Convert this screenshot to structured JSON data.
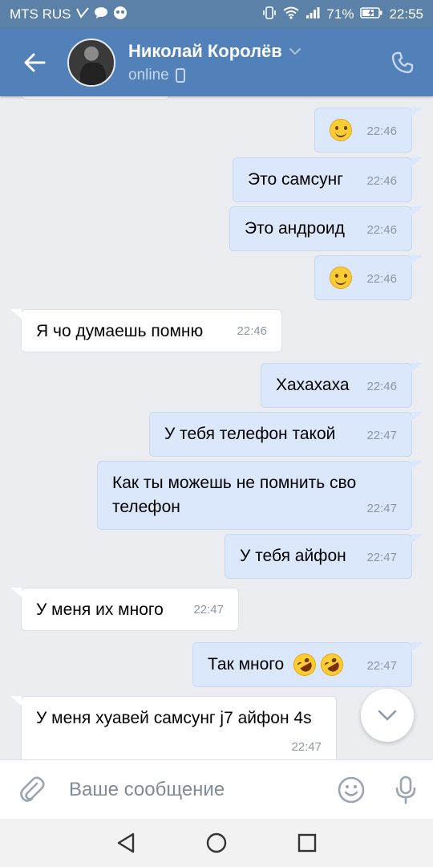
{
  "status_bar": {
    "carrier": "MTS RUS",
    "battery": "71%",
    "time": "22:55"
  },
  "header": {
    "contact_name": "Николай Королёв",
    "status": "online"
  },
  "messages": [
    {
      "direction": "out",
      "text": "",
      "emoji": [
        "smile"
      ],
      "time": "22:46"
    },
    {
      "direction": "out",
      "text": "Это самсунг",
      "time": "22:46"
    },
    {
      "direction": "out",
      "text": "Это андроид",
      "time": "22:46"
    },
    {
      "direction": "out",
      "text": "",
      "emoji": [
        "smile"
      ],
      "time": "22:46"
    },
    {
      "direction": "in",
      "text": "Я чо думаешь помню",
      "time": "22:46"
    },
    {
      "direction": "out",
      "text": "Хахахаха",
      "time": "22:46"
    },
    {
      "direction": "out",
      "text": "У тебя телефон такой",
      "time": "22:47"
    },
    {
      "direction": "out",
      "text": "Как ты можешь не помнить сво телефон",
      "time": "22:47"
    },
    {
      "direction": "out",
      "text": "У тебя айфон",
      "time": "22:47"
    },
    {
      "direction": "in",
      "text": "У меня их много",
      "time": "22:47"
    },
    {
      "direction": "out",
      "text": "Так много",
      "emoji": [
        "rofl",
        "rofl"
      ],
      "time": "22:47"
    },
    {
      "direction": "in",
      "text": "У меня хуавей самсунг j7 айфон 4s",
      "time": "22:47"
    }
  ],
  "composer": {
    "placeholder": "Ваше сообщение"
  },
  "colors": {
    "header_bg": "#5181b8",
    "outgoing_bubble": "#dbe7fa",
    "incoming_bubble": "#ffffff",
    "chat_bg": "#ebedf0"
  }
}
